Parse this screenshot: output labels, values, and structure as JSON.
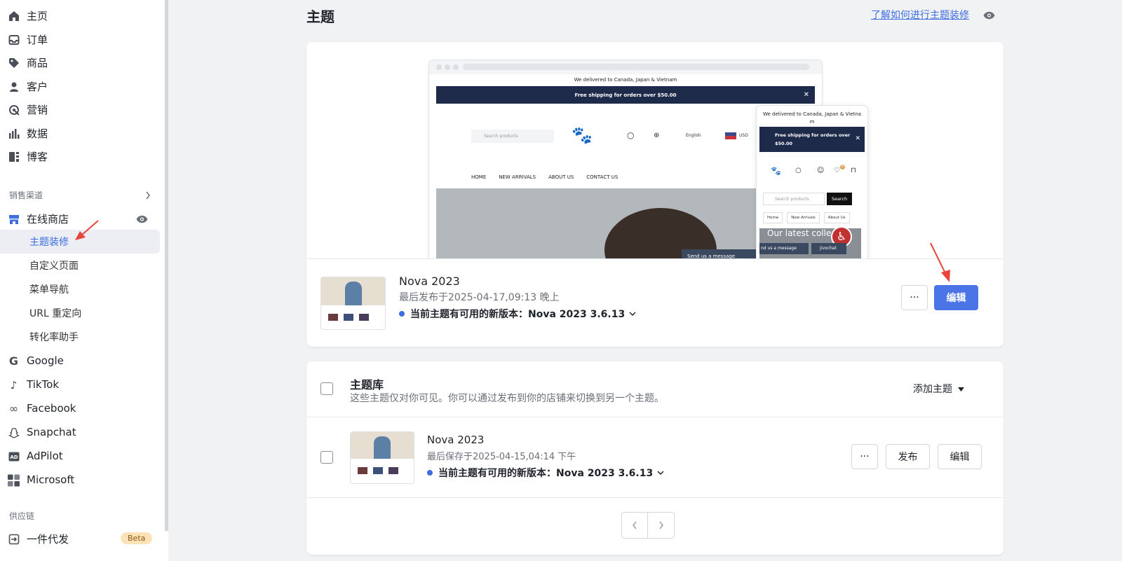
{
  "sidebar": {
    "nav": [
      {
        "label": "主页",
        "icon": "home-icon"
      },
      {
        "label": "订单",
        "icon": "inbox-icon"
      },
      {
        "label": "商品",
        "icon": "tag-icon"
      },
      {
        "label": "客户",
        "icon": "person-icon"
      },
      {
        "label": "营销",
        "icon": "target-icon"
      },
      {
        "label": "数据",
        "icon": "bar-chart-icon"
      },
      {
        "label": "博客",
        "icon": "blog-icon"
      }
    ],
    "sales_channel_label": "销售渠道",
    "online_store_label": "在线商店",
    "online_store_sub": [
      "主题装修",
      "自定义页面",
      "菜单导航",
      "URL 重定向",
      "转化率助手"
    ],
    "channels": [
      {
        "label": "Google",
        "icon": "google-icon"
      },
      {
        "label": "TikTok",
        "icon": "tiktok-icon"
      },
      {
        "label": "Facebook",
        "icon": "meta-icon"
      },
      {
        "label": "Snapchat",
        "icon": "snapchat-icon"
      },
      {
        "label": "AdPilot",
        "icon": "adpilot-icon"
      },
      {
        "label": "Microsoft",
        "icon": "microsoft-icon"
      }
    ],
    "supply_chain_label": "供应链",
    "dropship_label": "一件代发",
    "beta_badge": "Beta"
  },
  "header": {
    "title": "主题",
    "help_link": "了解如何进行主题装修"
  },
  "preview": {
    "desktop_announcement": "We delivered to Canada, Japan & Vietnam",
    "desktop_shipping": "Free shipping for orders over $50.00",
    "search_placeholder": "Search products",
    "language": "English",
    "currency": "USD",
    "nav": [
      "HOME",
      "NEW ARRIVALS",
      "ABOUT US",
      "CONTACT US"
    ],
    "send_message": "Send us a message",
    "mobile_announcement": "We delivered to Canada, Japan & Vietna m",
    "mobile_shipping": "Free shipping for orders over $50.00",
    "mobile_search_btn": "Search",
    "mobile_nav": [
      "Home",
      "New Arrivals",
      "About Us"
    ],
    "mobile_banner": "Our latest colle",
    "mobile_send_message": "nd us a message",
    "chat_label": "jivochat",
    "cart_count": "0"
  },
  "current_theme": {
    "name": "Nova 2023",
    "published": "最后发布于2025-04-17,09:13 晚上",
    "update_notice": "当前主题有可用的新版本：Nova 2023 3.6.13",
    "more_label": "···",
    "edit_label": "编辑"
  },
  "library": {
    "title": "主题库",
    "description": "这些主题仅对你可见。你可以通过发布到你的店铺来切换到另一个主题。",
    "add_theme": "添加主题",
    "items": [
      {
        "name": "Nova 2023",
        "saved": "最后保存于2025-04-15,04:14 下午",
        "update_notice": "当前主题有可用的新版本：Nova 2023 3.6.13",
        "more_label": "···",
        "publish_label": "发布",
        "edit_label": "编辑"
      }
    ]
  },
  "colors": {
    "accent": "#4b74e6",
    "link": "#3e6de0",
    "annotation_arrow": "#e8453c",
    "announcement_bar": "#1e2a4a"
  }
}
